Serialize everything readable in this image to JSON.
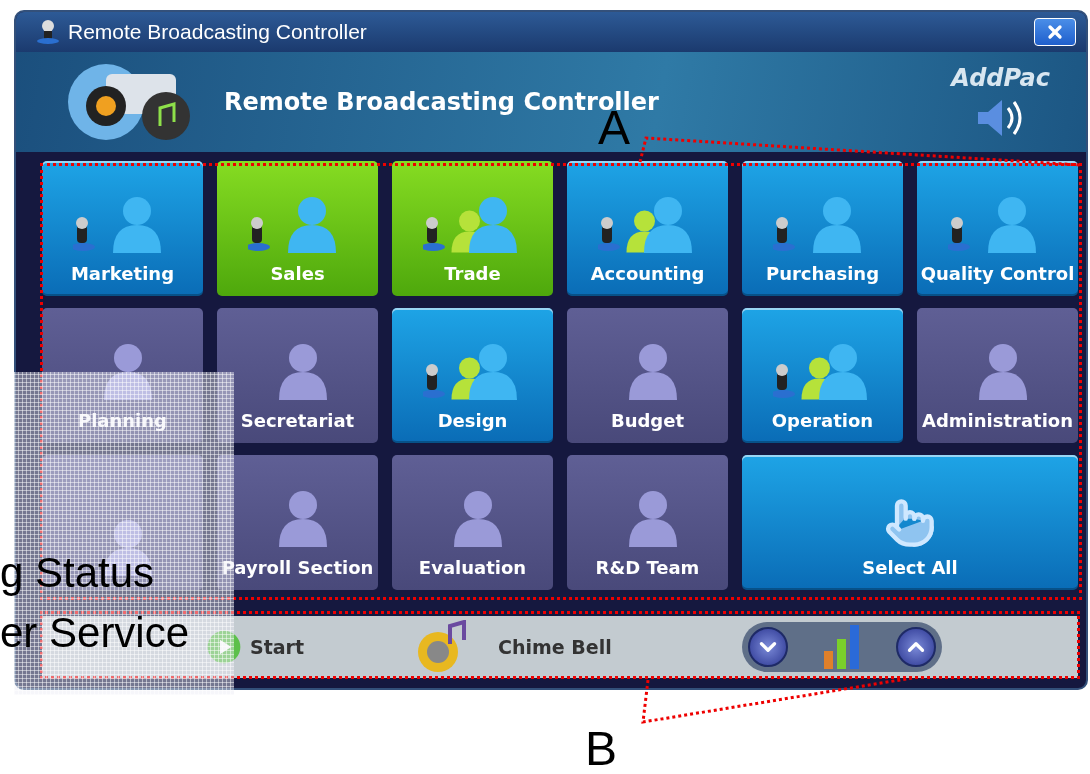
{
  "window": {
    "title": "Remote Broadcasting Controller"
  },
  "header": {
    "title": "Remote Broadcasting Controller",
    "brand": "AddPac"
  },
  "tiles": [
    {
      "label": "Marketing",
      "kind": "mic",
      "selected": false,
      "on": true
    },
    {
      "label": "Sales",
      "kind": "mic",
      "selected": true,
      "on": false
    },
    {
      "label": "Trade",
      "kind": "mic-group",
      "selected": true,
      "on": false
    },
    {
      "label": "Accounting",
      "kind": "mic-group",
      "selected": false,
      "on": true
    },
    {
      "label": "Purchasing",
      "kind": "mic",
      "selected": false,
      "on": true
    },
    {
      "label": "Quality Control",
      "kind": "mic",
      "selected": false,
      "on": true
    },
    {
      "label": "Planning",
      "kind": "single",
      "selected": false,
      "on": false
    },
    {
      "label": "Secretariat",
      "kind": "single",
      "selected": false,
      "on": false
    },
    {
      "label": "Design",
      "kind": "mic-group",
      "selected": false,
      "on": true
    },
    {
      "label": "Budget",
      "kind": "single",
      "selected": false,
      "on": false
    },
    {
      "label": "Operation",
      "kind": "mic-group",
      "selected": false,
      "on": true
    },
    {
      "label": "Administration",
      "kind": "single",
      "selected": false,
      "on": false
    },
    {
      "kind": "single",
      "selected": false,
      "on": false
    },
    {
      "label": "Payroll Section",
      "kind": "single",
      "selected": false,
      "on": false
    },
    {
      "label": "Evaluation",
      "kind": "single",
      "selected": false,
      "on": false
    },
    {
      "label": "R&D Team",
      "kind": "single",
      "selected": false,
      "on": false
    }
  ],
  "select_all": {
    "label": "Select All"
  },
  "bottom_bar": {
    "start": "Start",
    "chime": "Chime Bell"
  },
  "annotations": [
    {
      "label": "A"
    },
    {
      "label": "B"
    }
  ],
  "overlay": {
    "lines": [
      "g Status",
      "er Service"
    ]
  }
}
